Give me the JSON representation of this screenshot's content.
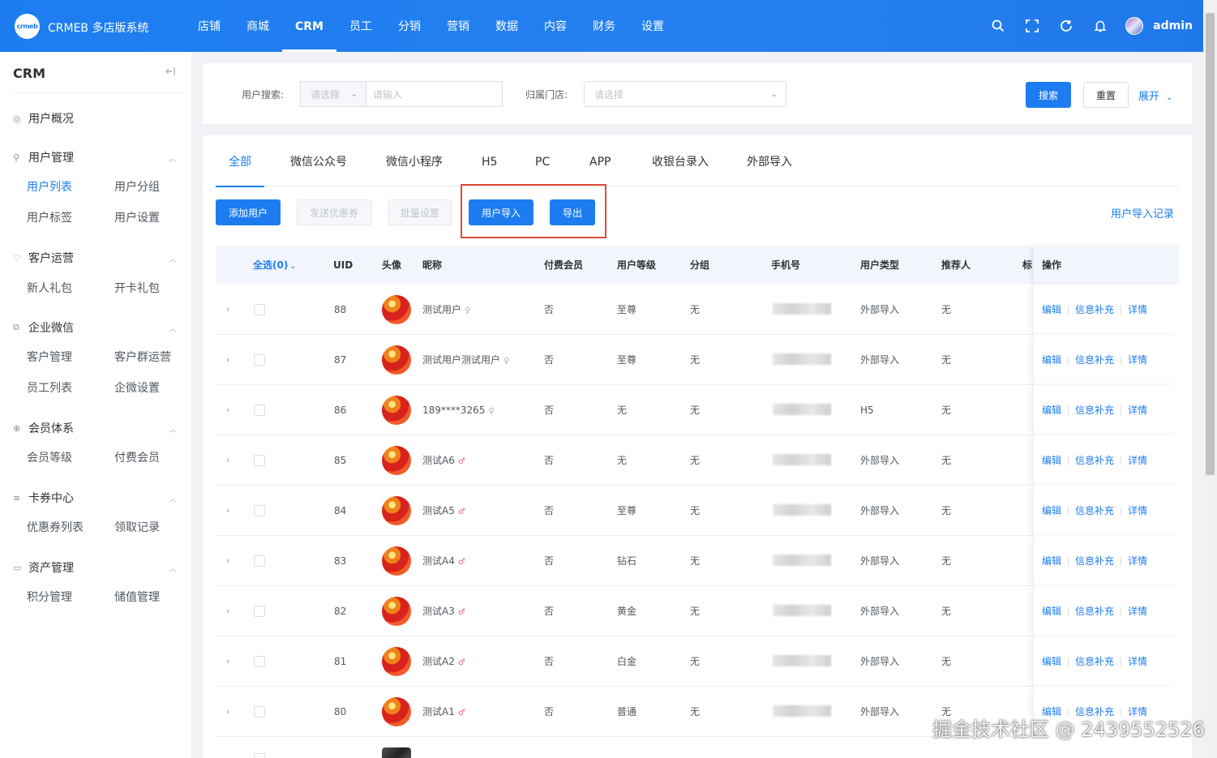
{
  "brand": {
    "logo_text": "crmeb",
    "title": "CRMEB 多店版系统"
  },
  "topnav": [
    "店铺",
    "商城",
    "CRM",
    "员工",
    "分销",
    "营销",
    "数据",
    "内容",
    "财务",
    "设置"
  ],
  "topnav_active": "CRM",
  "user": {
    "name": "admin"
  },
  "sidebar": {
    "title": "CRM",
    "groups": [
      {
        "label": "用户概况"
      },
      {
        "label": "用户管理",
        "items": [
          "用户列表",
          "用户分组",
          "用户标签",
          "用户设置"
        ]
      },
      {
        "label": "客户运营",
        "items": [
          "新人礼包",
          "开卡礼包"
        ]
      },
      {
        "label": "企业微信",
        "items": [
          "客户管理",
          "客户群运营",
          "员工列表",
          "企微设置"
        ]
      },
      {
        "label": "会员体系",
        "items": [
          "会员等级",
          "付费会员"
        ]
      },
      {
        "label": "卡券中心",
        "items": [
          "优惠券列表",
          "领取记录"
        ]
      },
      {
        "label": "资产管理",
        "items": [
          "积分管理",
          "储值管理"
        ]
      }
    ],
    "active_item": "用户列表"
  },
  "search": {
    "user_label": "用户搜索:",
    "user_select_placeholder": "请选择",
    "user_input_placeholder": "请输入",
    "store_label": "归属门店:",
    "store_placeholder": "请选择",
    "search_btn": "搜索",
    "reset_btn": "重置",
    "expand_link": "展开"
  },
  "tabs": [
    "全部",
    "微信公众号",
    "微信小程序",
    "H5",
    "PC",
    "APP",
    "收银台录入",
    "外部导入"
  ],
  "toolbar": {
    "add_user": "添加用户",
    "send_coupon": "发送优惠券",
    "batch_set": "批量设置",
    "import_user": "用户导入",
    "export": "导出",
    "import_record": "用户导入记录"
  },
  "table": {
    "headers": {
      "select_all": "全选(0)",
      "uid": "UID",
      "avatar": "头像",
      "nickname": "昵称",
      "paid_member": "付费会员",
      "level": "用户等级",
      "group": "分组",
      "phone": "手机号",
      "user_type": "用户类型",
      "referrer": "推荐人",
      "tag": "标",
      "ops": "操作"
    },
    "row_actions": {
      "edit": "编辑",
      "supplement": "信息补充",
      "detail": "详情"
    },
    "rows": [
      {
        "uid": "88",
        "nickname": "测试用户",
        "gender": "female",
        "paid": "否",
        "level": "至尊",
        "group": "无",
        "type": "外部导入",
        "referrer": "无"
      },
      {
        "uid": "87",
        "nickname": "测试用户测试用户",
        "gender": "female",
        "paid": "否",
        "level": "至尊",
        "group": "无",
        "type": "外部导入",
        "referrer": "无"
      },
      {
        "uid": "86",
        "nickname": "189****3265",
        "gender": "female",
        "paid": "否",
        "level": "无",
        "group": "无",
        "type": "H5",
        "referrer": "无"
      },
      {
        "uid": "85",
        "nickname": "测试A6",
        "gender": "male",
        "paid": "否",
        "level": "无",
        "group": "无",
        "type": "外部导入",
        "referrer": "无"
      },
      {
        "uid": "84",
        "nickname": "测试A5",
        "gender": "male",
        "paid": "否",
        "level": "至尊",
        "group": "无",
        "type": "外部导入",
        "referrer": "无"
      },
      {
        "uid": "83",
        "nickname": "测试A4",
        "gender": "male",
        "paid": "否",
        "level": "钻石",
        "group": "无",
        "type": "外部导入",
        "referrer": "无"
      },
      {
        "uid": "82",
        "nickname": "测试A3",
        "gender": "male",
        "paid": "否",
        "level": "黄金",
        "group": "无",
        "type": "外部导入",
        "referrer": "无"
      },
      {
        "uid": "81",
        "nickname": "测试A2",
        "gender": "male",
        "paid": "否",
        "level": "白金",
        "group": "无",
        "type": "外部导入",
        "referrer": "无"
      },
      {
        "uid": "80",
        "nickname": "测试A1",
        "gender": "male",
        "paid": "否",
        "level": "普通",
        "group": "无",
        "type": "外部导入",
        "referrer": "无"
      }
    ]
  },
  "watermark": "掘金技术社区 @ 2439552526",
  "colors": {
    "primary": "#1d7df0",
    "highlight_border": "#e04a3a",
    "female_icon": "#b0b3b8",
    "male_icon": "#f06090"
  }
}
